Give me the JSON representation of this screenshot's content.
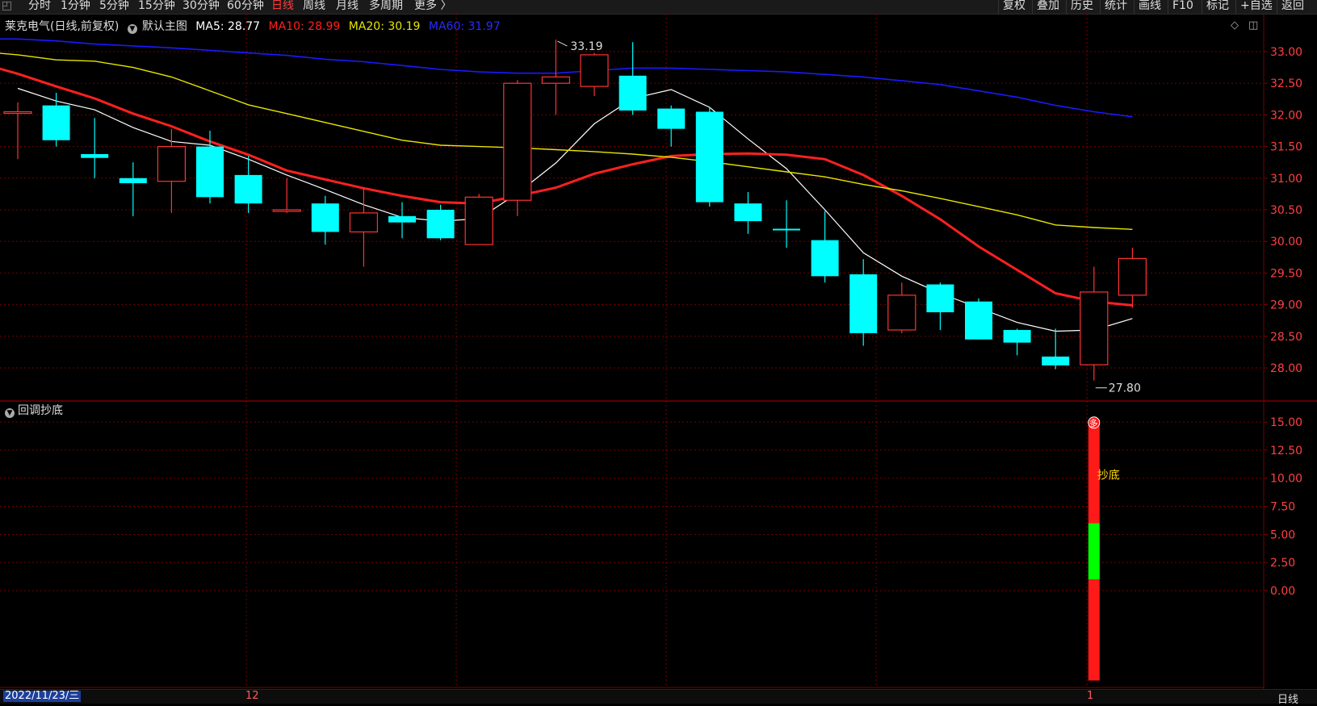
{
  "toolbar": {
    "periods": [
      "分时",
      "1分钟",
      "5分钟",
      "15分钟",
      "30分钟",
      "60分钟",
      "日线",
      "周线",
      "月线",
      "多周期",
      "更多 〉"
    ],
    "active_period": "日线",
    "right_buttons": [
      "复权",
      "叠加",
      "历史",
      "统计",
      "画线",
      "F10",
      "标记",
      "+自选",
      "返回"
    ]
  },
  "header": {
    "stock": "莱克电气",
    "mode": "(日线,前复权)",
    "template": "默认主图",
    "ma5": "MA5: 28.77",
    "ma10": "MA10: 28.99",
    "ma20": "MA20: 30.19",
    "ma60": "MA60: 31.97"
  },
  "indicator": {
    "name": "回调抄底",
    "signal_label": "抄底",
    "marker": "多"
  },
  "footer": {
    "date": "2022/11/23/三",
    "month_12": "12",
    "month_1": "1",
    "period": "日线"
  },
  "colors": {
    "up": "#ff3232",
    "down": "#00ffff",
    "ma5": "#ffffff",
    "ma10": "#ff2020",
    "ma20": "#e6e600",
    "ma60": "#1a1aff",
    "grid": "#7a0000",
    "bar_red": "#ff1a1a",
    "bar_green": "#00ff00"
  },
  "chart_data": [
    {
      "type": "candlestick",
      "title": "莱克电气 日线",
      "ylim": [
        27.7,
        33.2
      ],
      "yticks": [
        "33.00",
        "32.50",
        "32.00",
        "31.50",
        "31.00",
        "30.50",
        "30.00",
        "29.50",
        "29.00",
        "28.50",
        "28.00"
      ],
      "annotations": [
        {
          "label": "33.19"
        },
        {
          "label": "27.80"
        }
      ],
      "candles": [
        {
          "o": 32.05,
          "h": 32.2,
          "l": 31.3,
          "c": 32.05
        },
        {
          "o": 32.15,
          "h": 32.35,
          "l": 31.5,
          "c": 31.6
        },
        {
          "o": 31.38,
          "h": 31.95,
          "l": 31.0,
          "c": 31.32
        },
        {
          "o": 31.0,
          "h": 31.25,
          "l": 30.4,
          "c": 30.92
        },
        {
          "o": 30.95,
          "h": 31.78,
          "l": 30.45,
          "c": 31.5
        },
        {
          "o": 31.5,
          "h": 31.75,
          "l": 30.6,
          "c": 30.7
        },
        {
          "o": 31.05,
          "h": 31.35,
          "l": 30.45,
          "c": 30.6
        },
        {
          "o": 30.5,
          "h": 31.0,
          "l": 30.45,
          "c": 30.5
        },
        {
          "o": 30.6,
          "h": 30.72,
          "l": 29.95,
          "c": 30.15
        },
        {
          "o": 30.15,
          "h": 30.85,
          "l": 29.6,
          "c": 30.45
        },
        {
          "o": 30.4,
          "h": 30.62,
          "l": 30.05,
          "c": 30.3
        },
        {
          "o": 30.5,
          "h": 30.58,
          "l": 30.02,
          "c": 30.05
        },
        {
          "o": 29.95,
          "h": 30.75,
          "l": 29.95,
          "c": 30.7
        },
        {
          "o": 30.65,
          "h": 32.55,
          "l": 30.4,
          "c": 32.5
        },
        {
          "o": 32.5,
          "h": 33.19,
          "l": 32.0,
          "c": 32.6
        },
        {
          "o": 32.45,
          "h": 32.98,
          "l": 32.3,
          "c": 32.95
        },
        {
          "o": 32.62,
          "h": 33.15,
          "l": 32.0,
          "c": 32.07
        },
        {
          "o": 32.1,
          "h": 32.15,
          "l": 31.5,
          "c": 31.78
        },
        {
          "o": 32.05,
          "h": 32.12,
          "l": 30.55,
          "c": 30.62
        },
        {
          "o": 30.6,
          "h": 30.78,
          "l": 30.12,
          "c": 30.32
        },
        {
          "o": 30.2,
          "h": 30.65,
          "l": 29.9,
          "c": 30.18
        },
        {
          "o": 30.02,
          "h": 30.48,
          "l": 29.35,
          "c": 29.45
        },
        {
          "o": 29.48,
          "h": 29.72,
          "l": 28.35,
          "c": 28.55
        },
        {
          "o": 28.6,
          "h": 29.35,
          "l": 28.55,
          "c": 29.15
        },
        {
          "o": 29.32,
          "h": 29.35,
          "l": 28.6,
          "c": 28.88
        },
        {
          "o": 29.05,
          "h": 29.1,
          "l": 28.45,
          "c": 28.45
        },
        {
          "o": 28.6,
          "h": 28.62,
          "l": 28.2,
          "c": 28.4
        },
        {
          "o": 28.18,
          "h": 28.62,
          "l": 27.98,
          "c": 28.04
        },
        {
          "o": 28.05,
          "h": 29.6,
          "l": 27.8,
          "c": 29.2
        },
        {
          "o": 29.15,
          "h": 29.9,
          "l": 28.95,
          "c": 29.73
        }
      ],
      "series": [
        {
          "name": "MA5",
          "values": [
            32.42,
            32.22,
            32.08,
            31.8,
            31.58,
            31.52,
            31.3,
            31.05,
            30.82,
            30.58,
            30.38,
            30.32,
            30.36,
            30.76,
            31.24,
            31.86,
            32.26,
            32.4,
            32.12,
            31.62,
            31.15,
            30.5,
            29.82,
            29.45,
            29.18,
            28.95,
            28.72,
            28.58,
            28.6,
            28.78
          ]
        },
        {
          "name": "MA10",
          "values": [
            32.82,
            32.65,
            32.45,
            32.26,
            32.02,
            31.82,
            31.58,
            31.37,
            31.12,
            30.98,
            30.84,
            30.72,
            30.62,
            30.6,
            30.72,
            30.85,
            31.07,
            31.22,
            31.35,
            31.38,
            31.39,
            31.37,
            31.3,
            31.05,
            30.72,
            30.35,
            29.92,
            29.55,
            29.18,
            29.05,
            28.99
          ]
        },
        {
          "name": "MA20",
          "values": [
            33.08,
            33.0,
            32.95,
            32.87,
            32.85,
            32.75,
            32.6,
            32.38,
            32.16,
            32.02,
            31.88,
            31.74,
            31.6,
            31.52,
            31.5,
            31.48,
            31.45,
            31.42,
            31.38,
            31.33,
            31.26,
            31.18,
            31.1,
            31.02,
            30.9,
            30.8,
            30.68,
            30.55,
            30.42,
            30.26,
            30.22,
            30.19
          ]
        },
        {
          "name": "MA60",
          "values": [
            33.2,
            33.2,
            33.17,
            33.12,
            33.09,
            33.06,
            33.02,
            32.98,
            32.94,
            32.88,
            32.84,
            32.78,
            32.72,
            32.68,
            32.66,
            32.66,
            32.7,
            32.74,
            32.74,
            32.72,
            32.7,
            32.68,
            32.64,
            32.6,
            32.54,
            32.48,
            32.38,
            32.28,
            32.15,
            32.05,
            31.97
          ]
        }
      ]
    },
    {
      "type": "bar",
      "title": "回调抄底",
      "ylim": [
        -8,
        16
      ],
      "yticks": [
        "15.00",
        "12.50",
        "10.00",
        "7.50",
        "5.00",
        "2.50",
        "0.00"
      ],
      "bar_index": 28,
      "segments": [
        {
          "from": -8.0,
          "to": 1.0,
          "color": "red"
        },
        {
          "from": 1.0,
          "to": 6.0,
          "color": "green"
        },
        {
          "from": 6.0,
          "to": 15.0,
          "color": "red"
        }
      ]
    }
  ]
}
